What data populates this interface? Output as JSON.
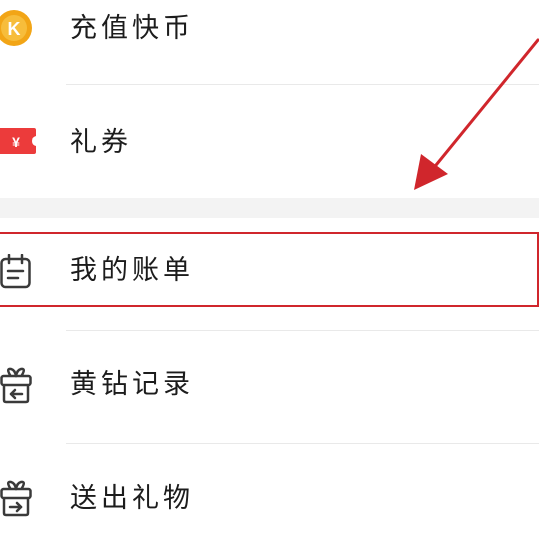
{
  "menu": {
    "items": [
      {
        "label": "充值快币",
        "icon": "k-coin-icon"
      },
      {
        "label": "礼券",
        "icon": "coupon-ticket-icon"
      },
      {
        "label": "我的账单",
        "icon": "calendar-bill-icon"
      },
      {
        "label": "黄钻记录",
        "icon": "gift-box-incoming-icon"
      },
      {
        "label": "送出礼物",
        "icon": "gift-box-outgoing-icon"
      }
    ],
    "coin_badge_letter": "K",
    "coupon_symbol": "¥",
    "highlighted_item": "我的账单"
  },
  "colors": {
    "coin": "#f2a516",
    "coupon": "#ec3b3b",
    "highlight": "#d0262c",
    "text": "#1c1c1c",
    "icon_stroke": "#3a3a3a"
  }
}
